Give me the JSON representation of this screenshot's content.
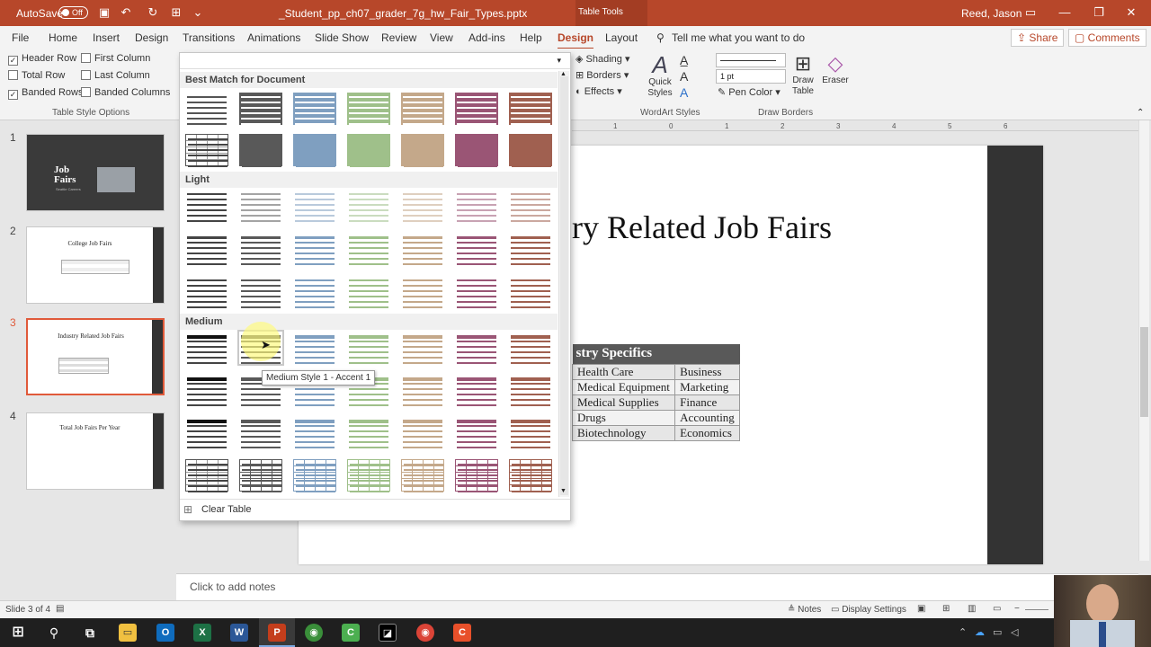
{
  "titlebar": {
    "autosave_label": "AutoSave",
    "autosave_state": "Off",
    "filename": "_Student_pp_ch07_grader_7g_hw_Fair_Types.pptx",
    "context": "Table Tools",
    "user": "Reed, Jason"
  },
  "tabs": [
    "File",
    "Home",
    "Insert",
    "Design",
    "Transitions",
    "Animations",
    "Slide Show",
    "Review",
    "View",
    "Add-ins",
    "Help",
    "Design",
    "Layout"
  ],
  "active_tab_index": 11,
  "tell_me": "Tell me what you want to do",
  "share_label": "Share",
  "comments_label": "Comments",
  "ribbon": {
    "options": [
      {
        "label": "Header Row",
        "checked": true
      },
      {
        "label": "First Column",
        "checked": false
      },
      {
        "label": "Total Row",
        "checked": false
      },
      {
        "label": "Last Column",
        "checked": false
      },
      {
        "label": "Banded Rows",
        "checked": true
      },
      {
        "label": "Banded Columns",
        "checked": false
      }
    ],
    "options_group_label": "Table Style Options",
    "shading": "Shading",
    "borders": "Borders",
    "effects": "Effects",
    "quick_styles": "Quick Styles",
    "wordart_group": "WordArt Styles",
    "pen_weight": "1 pt",
    "pen_color": "Pen Color",
    "draw_table": "Draw Table",
    "eraser": "Eraser",
    "draw_borders_group": "Draw Borders"
  },
  "gallery": {
    "sections": [
      "Best Match for Document",
      "Light",
      "Medium"
    ],
    "tooltip": "Medium Style 1 - Accent 1",
    "clear_table": "Clear Table",
    "accent_colors": [
      "#ffffff",
      "#595959",
      "#7f9fc0",
      "#9fc08a",
      "#c4a88a",
      "#9a5575",
      "#a06050"
    ]
  },
  "slides": [
    {
      "num": "1",
      "title": "Job Fairs",
      "subtitle": "Seattle Careers"
    },
    {
      "num": "2",
      "title": "College Job Fairs"
    },
    {
      "num": "3",
      "title": "Industry Related Job Fairs"
    },
    {
      "num": "4",
      "title": "Total Job Fairs Per Year"
    }
  ],
  "selected_slide": 2,
  "ruler_numbers": [
    "1",
    "0",
    "1",
    "2",
    "3",
    "4",
    "5",
    "6"
  ],
  "slide": {
    "title_visible": "ry Related Job Fairs",
    "table_header": "stry Specifics",
    "rows": [
      [
        "Health Care",
        "Business"
      ],
      [
        "Medical Equipment",
        "Marketing"
      ],
      [
        "Medical Supplies",
        "Finance"
      ],
      [
        "Drugs",
        "Accounting"
      ],
      [
        "Biotechnology",
        "Economics"
      ]
    ]
  },
  "notes_placeholder": "Click to add notes",
  "status": {
    "slide_info": "Slide 3 of 4",
    "notes": "Notes",
    "display_settings": "Display Settings"
  }
}
